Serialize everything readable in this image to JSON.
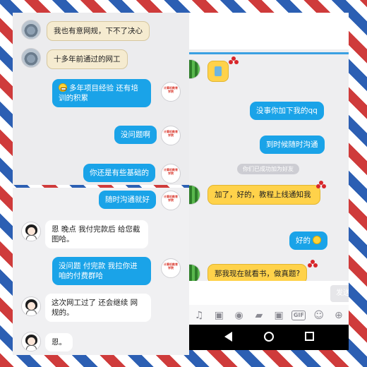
{
  "panel_top_left": {
    "messages": [
      {
        "side": "left",
        "text": "我也有意网规，下不了决心"
      },
      {
        "side": "left",
        "text": "十多年前通过的网工"
      },
      {
        "side": "right",
        "text": "多年项目经验 还有培训的积累",
        "emoji": "grin"
      },
      {
        "side": "right",
        "text": "没问题啊"
      },
      {
        "side": "right",
        "text": "你还是有些基础的"
      }
    ]
  },
  "panel_bottom_left": {
    "messages": [
      {
        "side": "right",
        "text": "随时沟通就好"
      },
      {
        "side": "left",
        "text": "恩 晚点 我付完款后 给您截图哈。"
      },
      {
        "side": "right",
        "text": "没问题 付完款 我拉你进咱的付费群哈"
      },
      {
        "side": "left",
        "text": "这次网工过了 还会继续 网规的。"
      },
      {
        "side": "left",
        "text": "恩。"
      }
    ]
  },
  "panel_right": {
    "messages": [
      {
        "side": "right",
        "text": "没事你加下我的qq"
      },
      {
        "side": "right",
        "text": "到时候随时沟通"
      },
      {
        "side": "left",
        "text": "加了，好的，教程上线通知我"
      },
      {
        "side": "right",
        "text": "好的",
        "emoji": "smile"
      },
      {
        "side": "left",
        "text": "那我现在就看书，做真题?"
      }
    ],
    "system_notice": "你们已成功加为好友",
    "send_label": "发送",
    "toolbar_icons": [
      "microphone-icon",
      "image-icon",
      "camera-icon",
      "red-packet-icon",
      "gift-icon",
      "gif-icon",
      "emoji-icon",
      "plus-icon"
    ],
    "gif_label": "GIF",
    "nav_icons": [
      "back-icon",
      "home-icon",
      "recent-apps-icon"
    ]
  },
  "avatar_logo_text": "计算机教育学院",
  "colors": {
    "bubble_blue": "#1aa3e8",
    "bubble_yellow": "#ffd24a",
    "bubble_tan": "#f5ebd0",
    "stripe_red": "#cf3b3b",
    "stripe_blue": "#2c5fb3"
  }
}
